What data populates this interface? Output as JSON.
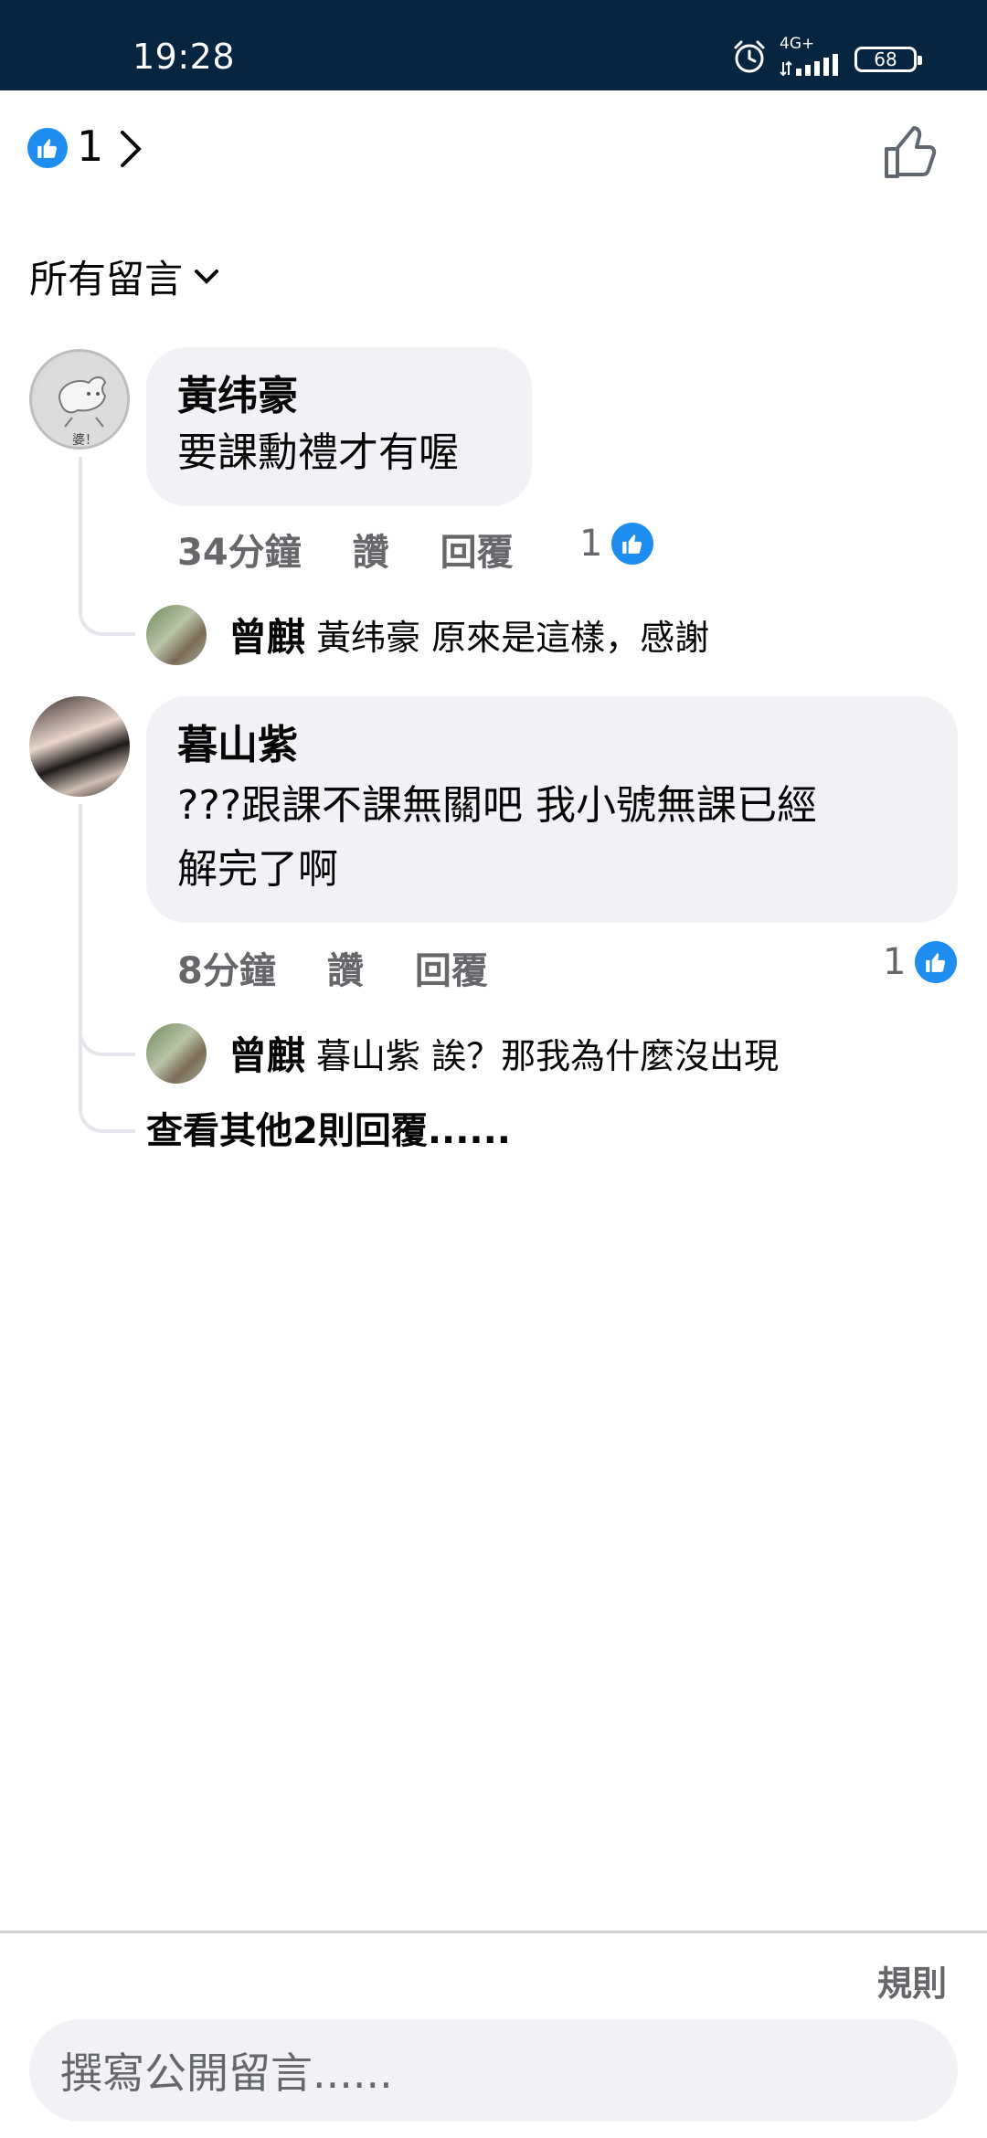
{
  "status_bar": {
    "time": "19:28",
    "network": "4G+",
    "battery": "68",
    "icons": [
      "alarm-icon",
      "signal-icon",
      "battery-icon"
    ]
  },
  "reactions": {
    "count": "1",
    "icon": "like-icon"
  },
  "filter": {
    "label": "所有留言",
    "icon": "chevron-down-icon"
  },
  "comments": [
    {
      "author": "黃纬豪",
      "text": "要課勳禮才有喔",
      "time": "34分鐘",
      "like_label": "讚",
      "reply_label": "回覆",
      "reaction_count": "1",
      "avatar_caption": "婆！",
      "replies": [
        {
          "author": "曾麒",
          "text": "黃纬豪 原來是這樣，感謝"
        }
      ]
    },
    {
      "author": "暮山紫",
      "text_line1": "???跟課不課無關吧 我小號無課已經",
      "text_line2": "解完了啊",
      "time": "8分鐘",
      "like_label": "讚",
      "reply_label": "回覆",
      "reaction_count": "1",
      "replies": [
        {
          "author": "曾麒",
          "text": "暮山紫 誒？那我為什麼沒出現"
        }
      ],
      "more_replies": "查看其他2則回覆......"
    }
  ],
  "footer": {
    "rules": "規則",
    "composer_placeholder": "撰寫公開留言......"
  },
  "colors": {
    "status_bar": "#062540",
    "facebook_blue": "#1d8df0",
    "bubble_bg": "#f0f2f5",
    "meta_text": "#65676b"
  }
}
